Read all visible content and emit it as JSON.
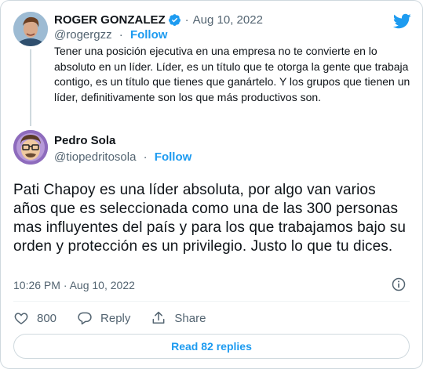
{
  "parent": {
    "name": "ROGER GONZALEZ",
    "date": "Aug 10, 2022",
    "handle": "@rogergzz",
    "follow_label": "Follow",
    "text": "Tener una posición ejecutiva en una empresa no te convierte en lo absoluto en un líder. Líder, es un título que te otorga la gente que trabaja contigo, es un título que tienes que ganártelo. Y los grupos que tienen un líder, definitivamente son los que más productivos son."
  },
  "main": {
    "name": "Pedro Sola",
    "handle": "@tiopedritosola",
    "follow_label": "Follow",
    "text": "Pati Chapoy es una líder absoluta, por algo van varios años que es seleccionada como una de las 300 personas mas influyentes del país y para los que trabajamos bajo su orden y protección es un privilegio. Justo lo que tu dices.",
    "timestamp": "10:26 PM · Aug 10, 2022"
  },
  "actions": {
    "like_count": "800",
    "reply_label": "Reply",
    "share_label": "Share"
  },
  "read_replies_label": "Read 82 replies",
  "separator": "·",
  "colors": {
    "accent": "#1d9bf0",
    "secondary_text": "#536471",
    "border": "#cfd9de"
  },
  "icons": [
    "verified-badge-icon",
    "twitter-bird-icon",
    "info-icon",
    "heart-icon",
    "reply-bubble-icon",
    "share-icon"
  ]
}
